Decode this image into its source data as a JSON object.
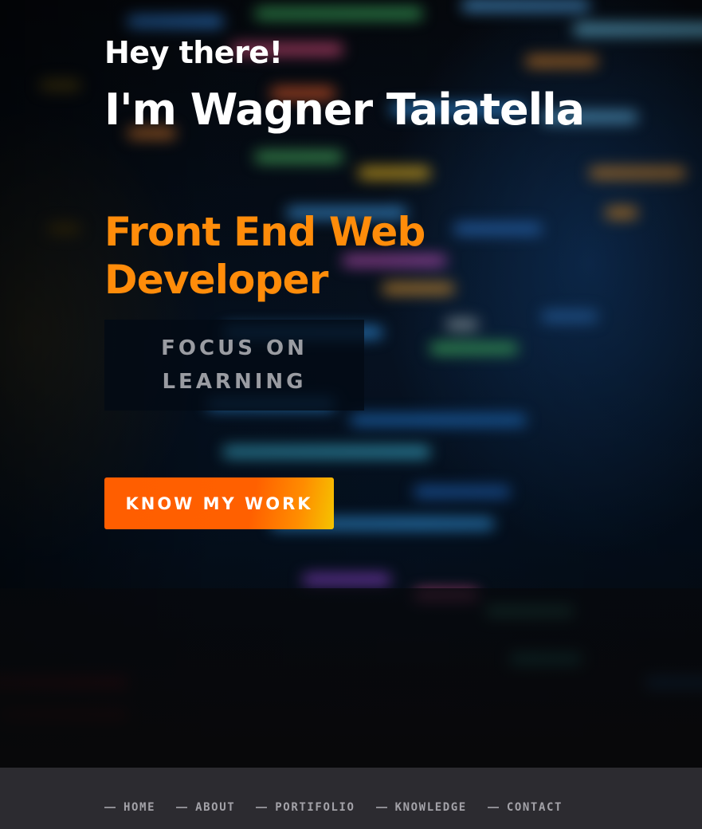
{
  "hero": {
    "greeting": "Hey there!",
    "name": "I'm Wagner Taiatella",
    "role": "Front End Web Developer",
    "focus": "FOCUS ON LEARNING",
    "cta_label": "KNOW MY WORK",
    "accent_color": "#ff8c0a",
    "cta_gradient": [
      "#ff5e00",
      "#f5c400"
    ]
  },
  "nav": {
    "items": [
      {
        "label": "HOME"
      },
      {
        "label": "ABOUT"
      },
      {
        "label": "PORTIFOLIO"
      },
      {
        "label": "KNOWLEDGE"
      },
      {
        "label": "CONTACT"
      }
    ],
    "background_color": "#2c2b30"
  }
}
